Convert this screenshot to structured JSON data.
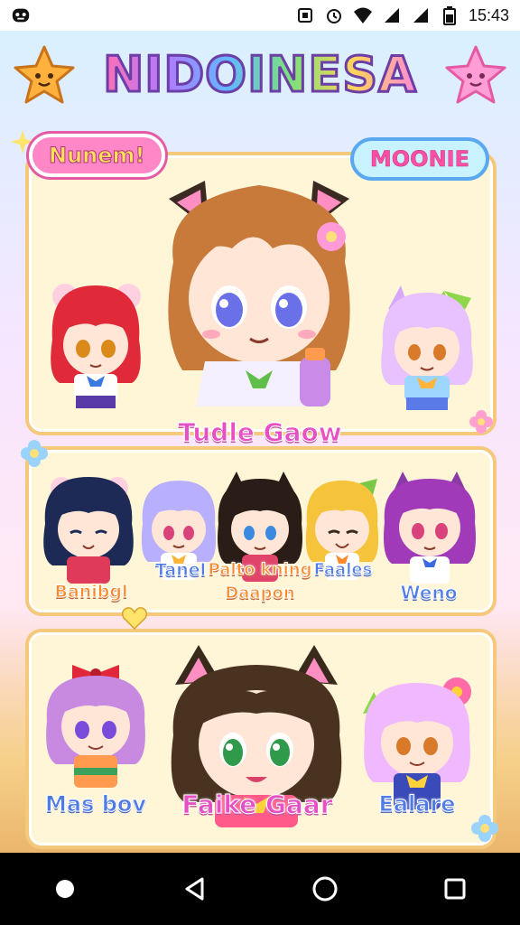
{
  "status_bar": {
    "time": "15:43",
    "icons": [
      "app-notification-icon",
      "nfc-icon",
      "alarm-icon",
      "wifi-icon",
      "signal-icon",
      "signal-icon-2",
      "battery-icon"
    ]
  },
  "app": {
    "title": "NIDOINESA",
    "colors": {
      "title_outline": "#6b3fa6",
      "panel_bg": "#fff6d8",
      "panel_border": "#f5c97c",
      "pink": "#ff87c8",
      "accent_blue": "#5aa9f0"
    },
    "featured": {
      "left_tag": "Nunem!",
      "right_tag": "MOONIE",
      "main_label": "Tudle Gaow"
    },
    "row2": {
      "labels": {
        "first": "Banibgl",
        "second": "Tanel",
        "third_line1": "Palto kning",
        "third_line2": "Daapon",
        "fourth": "Faales",
        "fifth": "Weno"
      }
    },
    "row3": {
      "left_label": "Mas bov",
      "center_label": "Faike Gaar",
      "right_label": "Ealare"
    }
  },
  "nav": {
    "icons": [
      "back-dot-icon",
      "back-triangle-icon",
      "home-circle-icon",
      "recents-square-icon"
    ]
  }
}
